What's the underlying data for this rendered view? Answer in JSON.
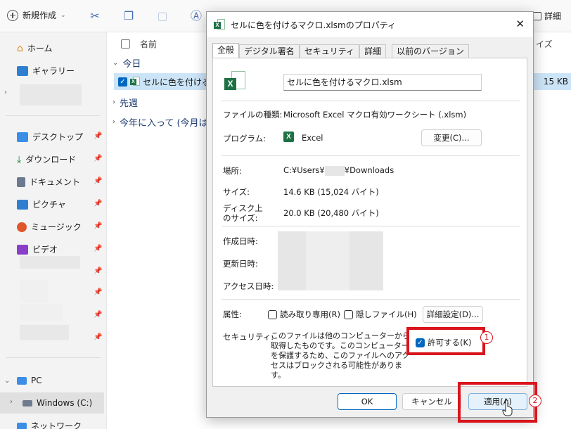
{
  "explorer": {
    "toolbar": {
      "new_label": "新規作成",
      "detail_label": "詳細"
    },
    "sidebar": {
      "home": "ホーム",
      "gallery": "ギャラリー",
      "desktop": "デスクトップ",
      "downloads": "ダウンロード",
      "documents": "ドキュメント",
      "pictures": "ピクチャ",
      "music": "ミュージック",
      "videos": "ビデオ",
      "pc": "PC",
      "drive": "Windows (C:)",
      "network": "ネットワーク"
    },
    "filelist": {
      "col_name": "名前",
      "col_size": "イズ",
      "group_today": "今日",
      "group_last_week": "先週",
      "group_this_year": "今年に入って (今月は",
      "file_name": "セルに色を付けるマク",
      "file_size": "15 KB"
    }
  },
  "dialog": {
    "title": "セルに色を付けるマクロ.xlsmのプロパティ",
    "tabs": [
      "全般",
      "デジタル署名",
      "セキュリティ",
      "詳細",
      "以前のバージョン"
    ],
    "file_name_value": "セルに色を付けるマクロ.xlsm",
    "file_type_label": "ファイルの種類:",
    "file_type_value": "Microsoft Excel マクロ有効ワークシート (.xlsm)",
    "program_label": "プログラム:",
    "program_value": "Excel",
    "change_button": "変更(C)...",
    "location_label": "場所:",
    "location_value_a": "C:¥Users¥",
    "location_value_b": "¥Downloads",
    "size_label": "サイズ:",
    "size_value": "14.6 KB (15,024 バイト)",
    "disk_size_label_1": "ディスク上",
    "disk_size_label_2": "のサイズ:",
    "disk_size_value": "20.0 KB (20,480 バイト)",
    "created_label": "作成日時:",
    "modified_label": "更新日時:",
    "accessed_label": "アクセス日時:",
    "attributes_label": "属性:",
    "readonly_label": "読み取り専用(R)",
    "hidden_label": "隠しファイル(H)",
    "advanced_button": "詳細設定(D)...",
    "security_label": "セキュリティ:",
    "security_text": "このファイルは他のコンピューターから取得したものです。このコンピューターを保護するため、このファイルへのアクセスはブロックされる可能性があります。",
    "unblock_label": "許可する(K)",
    "ok_button": "OK",
    "cancel_button": "キャンセル",
    "apply_button": "適用(A)"
  },
  "annotations": {
    "step1": "1",
    "step2": "2"
  },
  "colors": {
    "accent": "#0067c0",
    "annotation_red": "#d9141c",
    "excel_green": "#1e7145"
  }
}
